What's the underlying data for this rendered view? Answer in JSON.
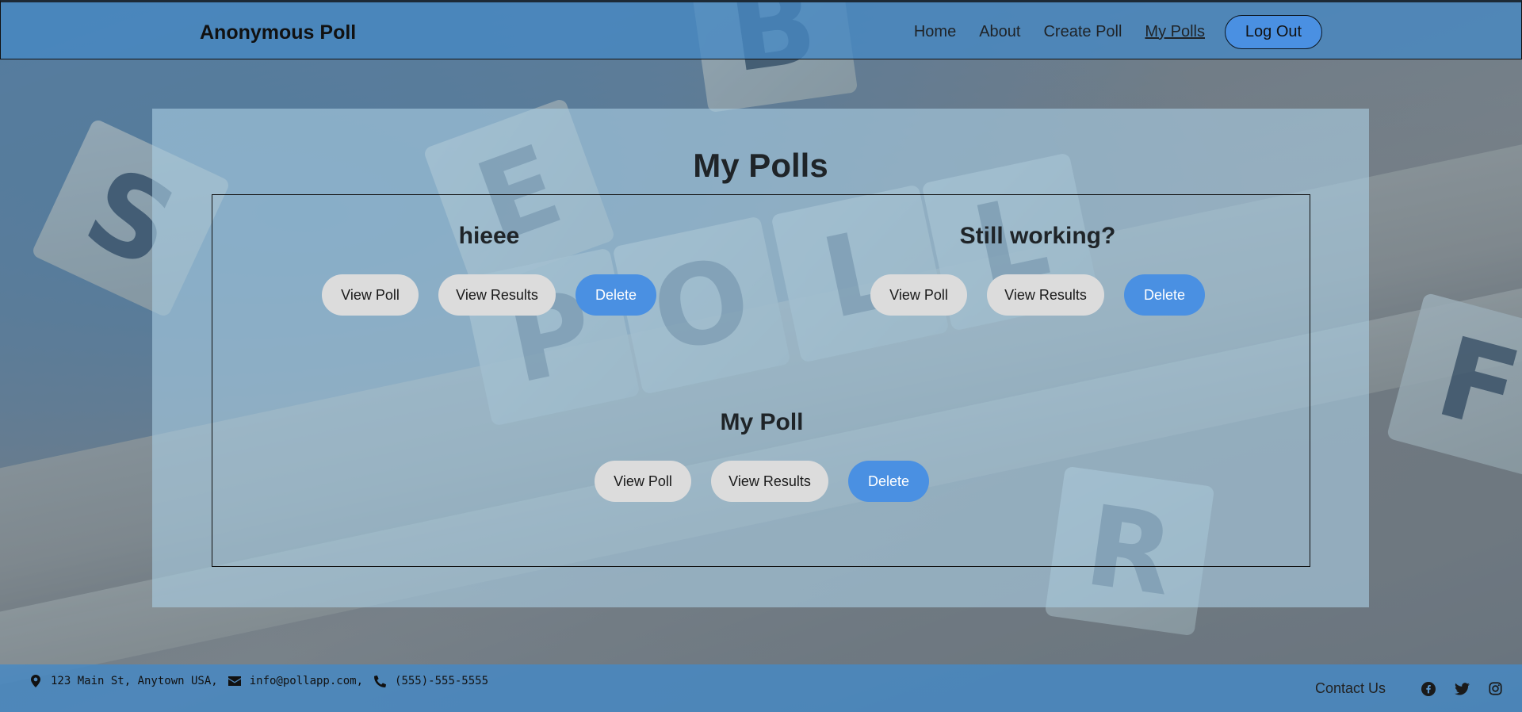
{
  "header": {
    "brand": "Anonymous Poll",
    "nav": [
      {
        "label": "Home",
        "active": false
      },
      {
        "label": "About",
        "active": false
      },
      {
        "label": "Create Poll",
        "active": false
      },
      {
        "label": "My Polls",
        "active": true
      }
    ],
    "logout_label": "Log Out"
  },
  "main": {
    "title": "My Polls",
    "polls": [
      {
        "title": "hieee",
        "view_label": "View Poll",
        "results_label": "View Results",
        "delete_label": "Delete"
      },
      {
        "title": "Still working?",
        "view_label": "View Poll",
        "results_label": "View Results",
        "delete_label": "Delete"
      },
      {
        "title": "My Poll",
        "view_label": "View Poll",
        "results_label": "View Results",
        "delete_label": "Delete"
      }
    ]
  },
  "footer": {
    "address": "123 Main St, Anytown USA,",
    "email": "info@pollapp.com,",
    "phone": "(555)-555-5555",
    "contact_label": "Contact Us",
    "social_icons": [
      "facebook-icon",
      "twitter-icon",
      "instagram-icon"
    ]
  },
  "colors": {
    "accent": "#4a90e2",
    "header_bg": "#4689c4",
    "button_grey": "#dcdcdc"
  }
}
